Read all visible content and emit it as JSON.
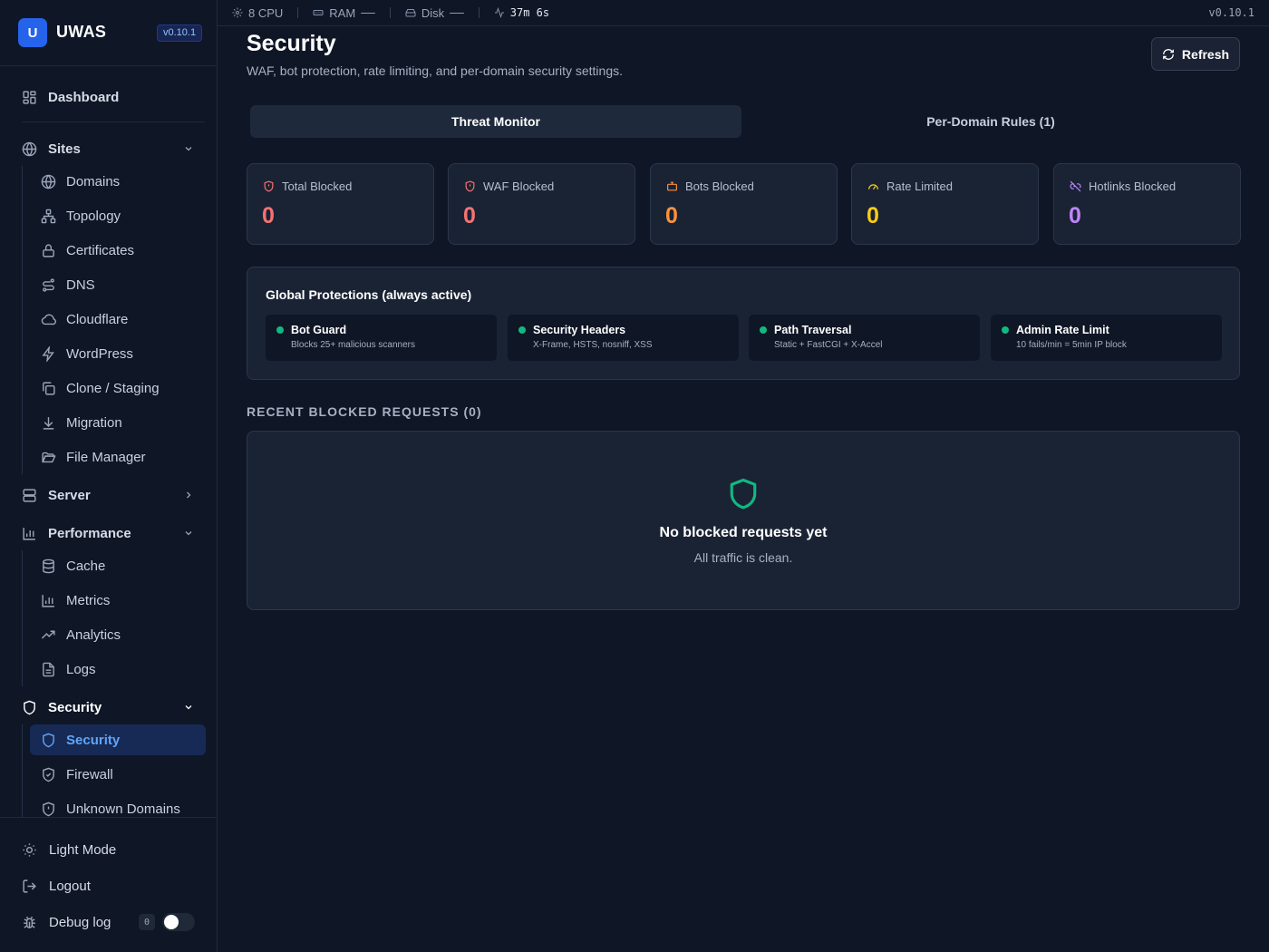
{
  "brand": {
    "logo_letter": "U",
    "name": "UWAS",
    "version": "v0.10.1"
  },
  "sidebar": {
    "dashboard": "Dashboard",
    "sites": {
      "label": "Sites",
      "items": [
        "Domains",
        "Topology",
        "Certificates",
        "DNS",
        "Cloudflare",
        "WordPress",
        "Clone / Staging",
        "Migration",
        "File Manager"
      ]
    },
    "server": {
      "label": "Server"
    },
    "performance": {
      "label": "Performance",
      "items": [
        "Cache",
        "Metrics",
        "Analytics",
        "Logs"
      ]
    },
    "security": {
      "label": "Security",
      "items": [
        "Security",
        "Firewall",
        "Unknown Domains"
      ],
      "active": "Security"
    },
    "bottom": {
      "light_mode": "Light Mode",
      "logout": "Logout",
      "debug_log": "Debug log",
      "debug_count": "0"
    }
  },
  "statusbar": {
    "cpu": "8 CPU",
    "ram_label": "RAM",
    "ram_value": "——",
    "disk_label": "Disk",
    "disk_value": "——",
    "uptime": "37m 6s",
    "version": "v0.10.1"
  },
  "page": {
    "title": "Security",
    "subtitle": "WAF, bot protection, rate limiting, and per-domain security settings.",
    "refresh_label": "Refresh",
    "tabs": [
      {
        "label": "Threat Monitor",
        "active": true
      },
      {
        "label": "Per-Domain Rules (1)",
        "active": false
      }
    ],
    "stats": [
      {
        "label": "Total Blocked",
        "value": "0",
        "color": "#f87171",
        "icon": "shield-alert-icon"
      },
      {
        "label": "WAF Blocked",
        "value": "0",
        "color": "#f87171",
        "icon": "shield-alert-icon"
      },
      {
        "label": "Bots Blocked",
        "value": "0",
        "color": "#fb923c",
        "icon": "bot-icon"
      },
      {
        "label": "Rate Limited",
        "value": "0",
        "color": "#facc15",
        "icon": "gauge-icon"
      },
      {
        "label": "Hotlinks Blocked",
        "value": "0",
        "color": "#c084fc",
        "icon": "link-off-icon"
      }
    ],
    "global_protections": {
      "title": "Global Protections (always active)",
      "items": [
        {
          "name": "Bot Guard",
          "desc": "Blocks 25+ malicious scanners"
        },
        {
          "name": "Security Headers",
          "desc": "X-Frame, HSTS, nosniff, XSS"
        },
        {
          "name": "Path Traversal",
          "desc": "Static + FastCGI + X-Accel"
        },
        {
          "name": "Admin Rate Limit",
          "desc": "10 fails/min = 5min IP block"
        }
      ]
    },
    "recent": {
      "label": "RECENT BLOCKED REQUESTS (0)",
      "empty_title": "No blocked requests yet",
      "empty_sub": "All traffic is clean."
    }
  }
}
